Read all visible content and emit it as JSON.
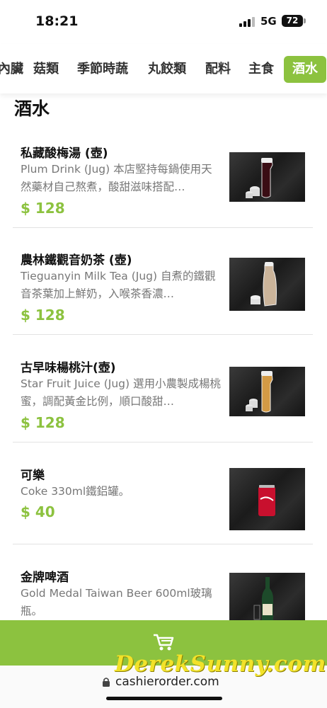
{
  "status_bar": {
    "time": "18:21",
    "network": "5G",
    "battery": "72"
  },
  "categories": [
    {
      "label": "內臟",
      "active": false
    },
    {
      "label": "菇類",
      "active": false
    },
    {
      "label": "季節時蔬",
      "active": false
    },
    {
      "label": "丸餃類",
      "active": false
    },
    {
      "label": "配料",
      "active": false
    },
    {
      "label": "主食",
      "active": false
    },
    {
      "label": "酒水",
      "active": true
    }
  ],
  "section_title": "酒水",
  "items": [
    {
      "name": "私藏酸梅湯 (壺)",
      "desc": "Plum Drink (Jug) 本店堅持每鍋使用天然藥材自己熬煮，酸甜滋味搭配…",
      "price": "$ 128"
    },
    {
      "name": "農林鐵觀音奶茶 (壺)",
      "desc": "Tieguanyin Milk Tea (Jug) 自煮的鐵觀音茶葉加上鮮奶，入喉茶香濃…",
      "price": "$ 128"
    },
    {
      "name": "古早味楊桃汁(壺)",
      "desc": "Star Fruit Juice (Jug) 選用小農製成楊桃蜜，調配黃金比例，順口酸甜…",
      "price": "$ 128"
    },
    {
      "name": "可樂",
      "desc": "Coke 330ml鐵鋁罐。",
      "price": "$ 40"
    },
    {
      "name": "金牌啤酒",
      "desc": "Gold Medal Taiwan Beer 600ml玻璃瓶。",
      "price": ""
    }
  ],
  "url": "cashierorder.com",
  "watermark": "DerekSunny.com",
  "colors": {
    "accent": "#8cc23f",
    "watermark": "#f2e229"
  }
}
